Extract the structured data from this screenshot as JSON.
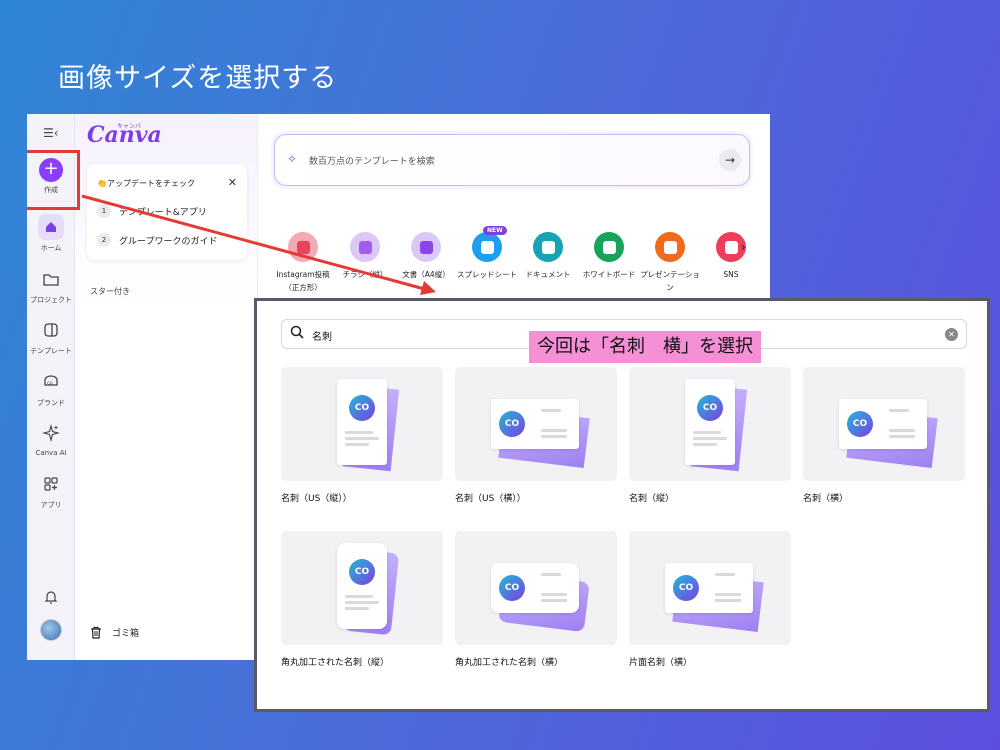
{
  "slide_title": "画像サイズを選択する",
  "rail": {
    "menu_icon": "menu-collapse-icon",
    "items": [
      {
        "label": "作成",
        "icon": "plus-icon"
      },
      {
        "label": "ホーム",
        "icon": "home-icon"
      },
      {
        "label": "プロジェクト",
        "icon": "folder-icon"
      },
      {
        "label": "テンプレート",
        "icon": "template-icon"
      },
      {
        "label": "ブランド",
        "icon": "brand-icon"
      },
      {
        "label": "Canva AI",
        "icon": "sparkle-icon"
      },
      {
        "label": "アプリ",
        "icon": "apps-icon"
      }
    ]
  },
  "side_panel": {
    "logo": "Canva",
    "logo_kana": "キャンバ",
    "update_title": "👏アップデートをチェック",
    "update_items": [
      {
        "num": "1",
        "label": "テンプレート&アプリ"
      },
      {
        "num": "2",
        "label": "グループワークのガイド"
      }
    ],
    "starred": "スター付き",
    "trash": "ゴミ箱"
  },
  "main": {
    "search_placeholder": "数百万点のテンプレートを検索",
    "categories": [
      {
        "label": "Instagram投稿（正方形）",
        "color": "#f3a9b6",
        "inner": "#e8445a"
      },
      {
        "label": "チラシ（縦）",
        "color": "#ddc7f7",
        "inner": "#a35cf0"
      },
      {
        "label": "文書（A4縦）",
        "color": "#d9c9f8",
        "inner": "#8c44e6"
      },
      {
        "label": "スプレッドシート",
        "color": "#1f9ef0",
        "inner": "#ffffff",
        "badge": "NEW"
      },
      {
        "label": "ドキュメント",
        "color": "#16a3b4",
        "inner": "#ffffff"
      },
      {
        "label": "ホワイトボード",
        "color": "#17a35a",
        "inner": "#ffffff"
      },
      {
        "label": "プレゼンテーション",
        "color": "#f26a1c",
        "inner": "#ffffff"
      },
      {
        "label": "SNS",
        "color": "#ef3e5c",
        "inner": "#ffffff"
      }
    ]
  },
  "results": {
    "query": "名刺",
    "callout": "今回は「名刺　横」を選択",
    "tiles": [
      {
        "label": "名刺（US（縦））",
        "orientation": "vertical"
      },
      {
        "label": "名刺（US（横））",
        "orientation": "horizontal"
      },
      {
        "label": "名刺（縦）",
        "orientation": "vertical"
      },
      {
        "label": "名刺（横）",
        "orientation": "horizontal"
      },
      {
        "label": "角丸加工された名刺（縦）",
        "orientation": "vertical-rounded"
      },
      {
        "label": "角丸加工された名刺（横）",
        "orientation": "horizontal-rounded"
      },
      {
        "label": "片面名刺（横）",
        "orientation": "horizontal"
      }
    ],
    "logo_text": "CO"
  },
  "colors": {
    "accent": "#8b3dff",
    "highlight_box": "#e53935",
    "callout_bg": "#f58fd6"
  }
}
